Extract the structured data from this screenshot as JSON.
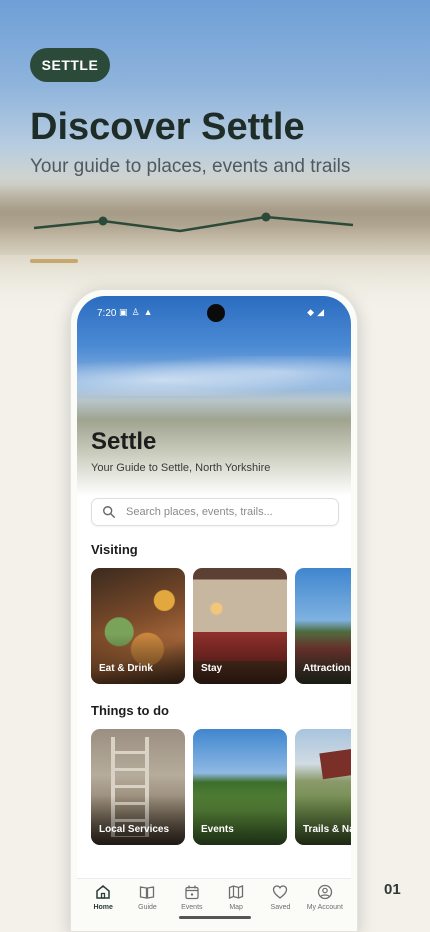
{
  "brand": {
    "pill_label": "SETTLE"
  },
  "hero": {
    "title": "Discover Settle",
    "subtitle": "Your guide to places, events and trails"
  },
  "page_number": "01",
  "colors": {
    "brand_green": "#2c4a3a",
    "accent_gold": "#c7a76b"
  },
  "phone": {
    "status_bar": {
      "time": "7:20",
      "left_icons": [
        "photo-icon",
        "person-icon",
        "warning-icon"
      ],
      "right_icons": [
        "wifi-icon",
        "signal-icon"
      ]
    },
    "app": {
      "title": "Settle",
      "subtitle": "Your Guide to Settle, North Yorkshire",
      "search": {
        "placeholder": "Search places, events, trails..."
      },
      "sections": [
        {
          "title": "Visiting",
          "cards": [
            {
              "label": "Eat & Drink"
            },
            {
              "label": "Stay"
            },
            {
              "label": "Attractions"
            }
          ]
        },
        {
          "title": "Things to do",
          "cards": [
            {
              "label": "Local Services"
            },
            {
              "label": "Events"
            },
            {
              "label": "Trails & Nat"
            }
          ]
        }
      ],
      "bottom_nav": [
        {
          "label": "Home",
          "icon": "home-icon",
          "active": true
        },
        {
          "label": "Guide",
          "icon": "book-icon",
          "active": false
        },
        {
          "label": "Events",
          "icon": "calendar-icon",
          "active": false
        },
        {
          "label": "Map",
          "icon": "map-icon",
          "active": false
        },
        {
          "label": "Saved",
          "icon": "heart-icon",
          "active": false
        },
        {
          "label": "My Account",
          "icon": "account-icon",
          "active": false
        }
      ]
    }
  }
}
